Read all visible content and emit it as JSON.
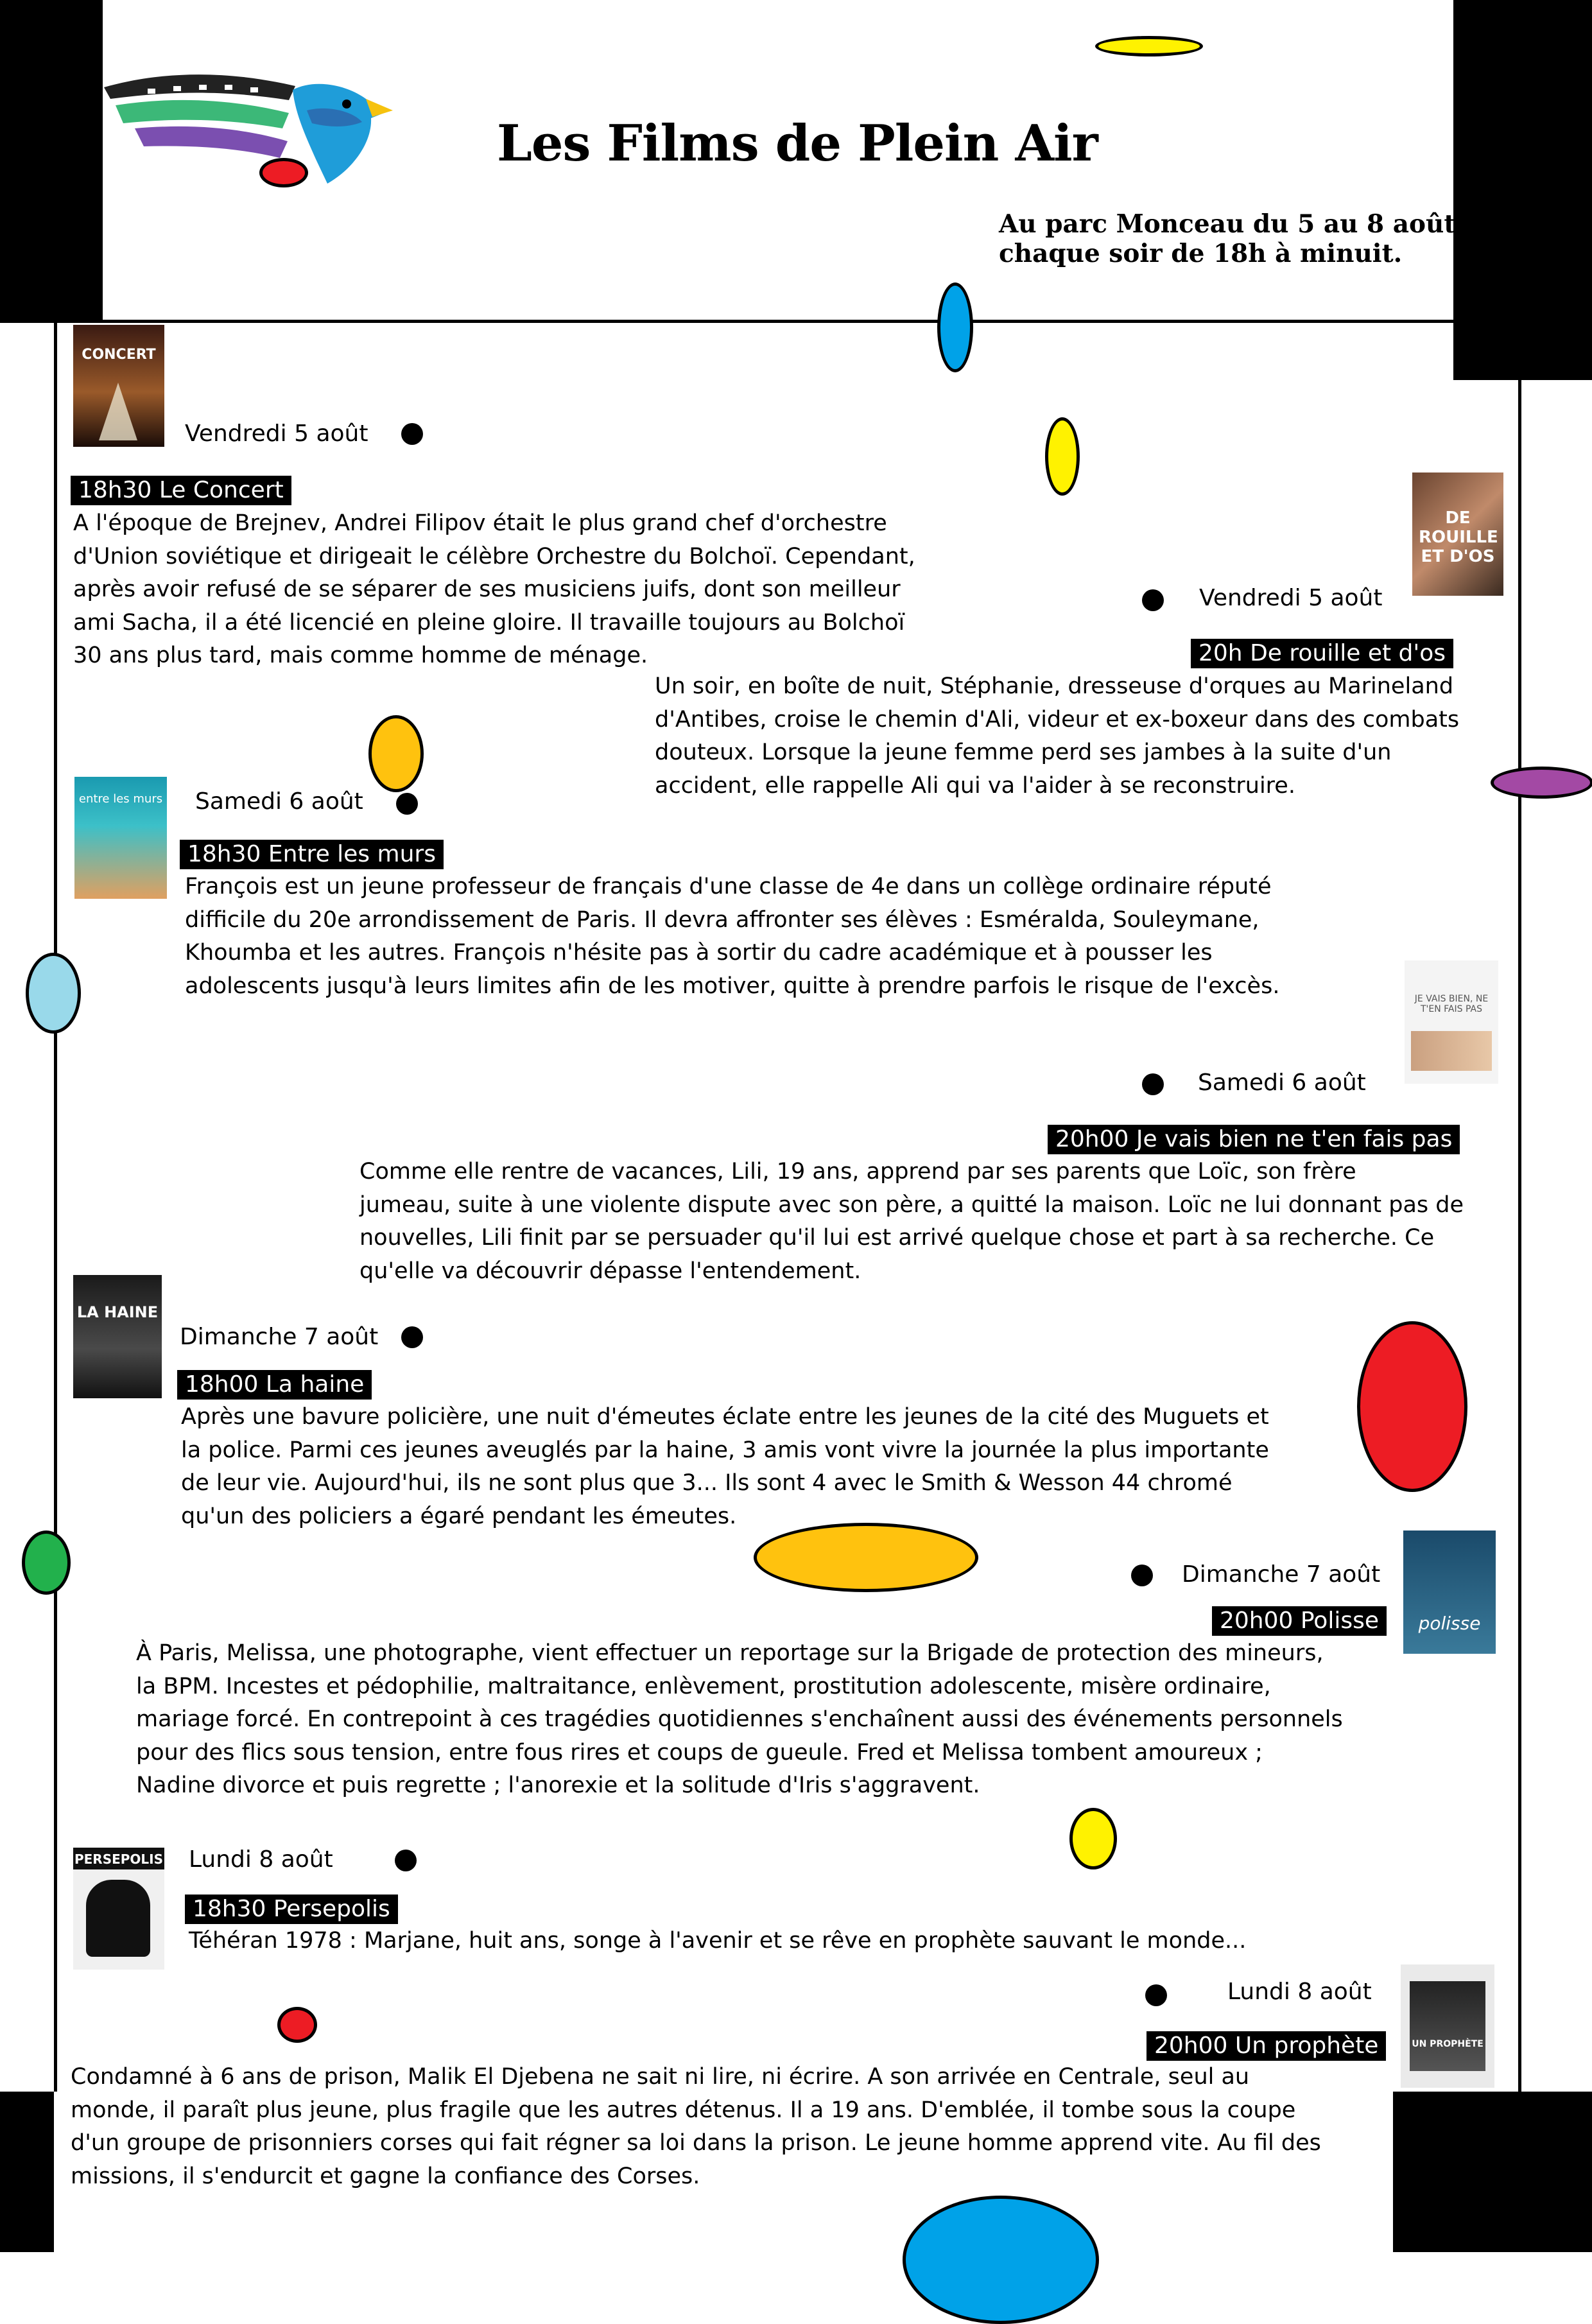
{
  "header": {
    "title": "Les Films de Plein Air",
    "subtitle_line1": "Au parc Monceau du 5 au 8 août,",
    "subtitle_line2": "chaque soir de 18h à minuit."
  },
  "colors": {
    "red": "#ed1c24",
    "yellow": "#fff200",
    "gold": "#ffc20e",
    "blue": "#00a2e8",
    "lightblue": "#99d9ea",
    "green": "#22b14c",
    "purple": "#a349a4",
    "black": "#000000"
  },
  "screenings": [
    {
      "date": "Vendredi 5 août",
      "film": "18h30 Le Concert",
      "poster_text": "CONCERT",
      "lines": [
        "A l'époque de Brejnev, Andrei Filipov était le plus grand chef d'orchestre",
        "d'Union soviétique et dirigeait le célèbre Orchestre du Bolchoï. Cependant,",
        "après avoir refusé de se séparer de ses musiciens juifs, dont son meilleur",
        "ami Sacha, il a été licencié en pleine gloire. Il travaille toujours au Bolchoï",
        "30 ans plus tard, mais comme homme de ménage."
      ]
    },
    {
      "date": "Vendredi 5 août",
      "film": "20h De rouille et d'os",
      "poster_text": "DE ROUILLE ET D'OS",
      "lines": [
        "Un soir, en boîte de nuit, Stéphanie, dresseuse d'orques au Marineland",
        "d'Antibes, croise le chemin d'Ali, videur et ex-boxeur dans des combats",
        "douteux. Lorsque la jeune femme perd ses jambes à la suite d'un",
        "accident, elle rappelle Ali qui va l'aider à se reconstruire."
      ]
    },
    {
      "date": "Samedi 6 août",
      "film": "18h30 Entre les murs",
      "poster_text": "entre les murs",
      "lines": [
        "François est un jeune professeur de français d'une classe de 4e dans un collège ordinaire réputé",
        "difficile du 20e arrondissement de Paris. Il devra affronter ses élèves : Esméralda, Souleymane,",
        "Khoumba et les autres. François n'hésite pas à sortir du cadre académique et à pousser les",
        "adolescents jusqu'à leurs limites afin de les motiver, quitte à prendre parfois le risque de l'excès."
      ]
    },
    {
      "date": "Samedi 6 août",
      "film": "20h00 Je vais bien ne t'en fais pas",
      "poster_text": "JE VAIS BIEN, NE T'EN FAIS PAS",
      "lines": [
        "Comme elle rentre de vacances, Lili, 19 ans, apprend par ses parents que Loïc, son frère",
        "jumeau, suite à une violente dispute avec son père, a quitté la maison. Loïc ne lui donnant pas de",
        "nouvelles, Lili finit par se persuader qu'il lui est arrivé quelque chose et part à sa recherche. Ce",
        "qu'elle va découvrir dépasse l'entendement."
      ]
    },
    {
      "date": "Dimanche 7 août",
      "film": "18h00 La haine",
      "poster_text": "LA HAINE",
      "lines": [
        "Après une bavure policière, une nuit d'émeutes éclate entre les jeunes de la cité des Muguets et",
        "la police. Parmi ces jeunes aveuglés par la haine, 3 amis vont vivre la journée la plus importante",
        "de leur vie. Aujourd'hui, ils ne sont plus que 3... Ils sont 4 avec le Smith & Wesson 44 chromé",
        "qu'un des policiers a égaré pendant les émeutes."
      ]
    },
    {
      "date": "Dimanche 7 août",
      "film": "20h00 Polisse",
      "poster_text": "polisse",
      "lines": [
        "À Paris, Melissa, une photographe, vient effectuer un reportage sur la Brigade de protection des mineurs,",
        "la BPM. Incestes et pédophilie, maltraitance, enlèvement, prostitution adolescente, misère ordinaire,",
        "mariage forcé. En contrepoint à ces tragédies quotidiennes s'enchaînent aussi des événements personnels",
        "pour des flics sous tension, entre fous rires et coups de gueule. Fred et Melissa tombent amoureux ;",
        "Nadine divorce et puis regrette ; l'anorexie et la solitude d'Iris s'aggravent."
      ]
    },
    {
      "date": "Lundi 8 août",
      "film": "18h30 Persepolis",
      "poster_text": "PERSEPOLIS",
      "lines": [
        "Téhéran 1978 : Marjane, huit ans, songe à l'avenir et se rêve en prophète sauvant le monde..."
      ]
    },
    {
      "date": "Lundi 8 août",
      "film": "20h00 Un prophète",
      "poster_text": "UN PROPHÈTE",
      "lines": [
        "Condamné à 6 ans de prison, Malik El Djebena ne sait ni lire, ni écrire. A son arrivée en Centrale, seul au",
        "monde, il paraît plus jeune, plus fragile que les autres détenus. Il a 19 ans. D'emblée, il tombe sous la coupe",
        "d'un groupe de prisonniers corses qui fait régner sa loi dans la prison. Le jeune homme apprend vite. Au fil des",
        "missions, il s'endurcit et gagne la confiance des Corses."
      ]
    }
  ]
}
